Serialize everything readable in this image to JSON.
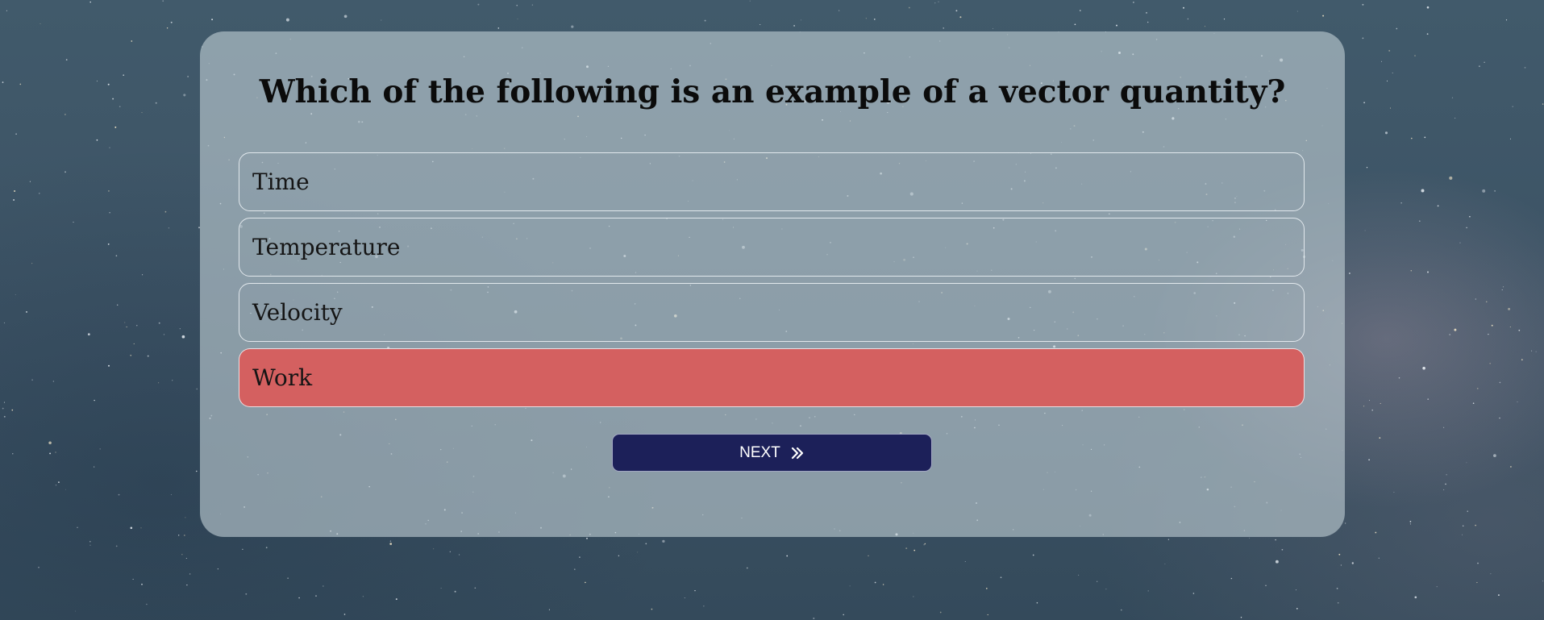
{
  "quiz": {
    "question": "Which of the following is an example of a vector quantity?",
    "options": [
      {
        "label": "Time",
        "selected": false
      },
      {
        "label": "Temperature",
        "selected": false
      },
      {
        "label": "Velocity",
        "selected": false
      },
      {
        "label": "Work",
        "selected": true
      }
    ],
    "selected_option_color": "#d46060",
    "next_label": "NEXT",
    "next_icon": "double-chevron-right-icon",
    "next_button_color": "#1c2059"
  }
}
